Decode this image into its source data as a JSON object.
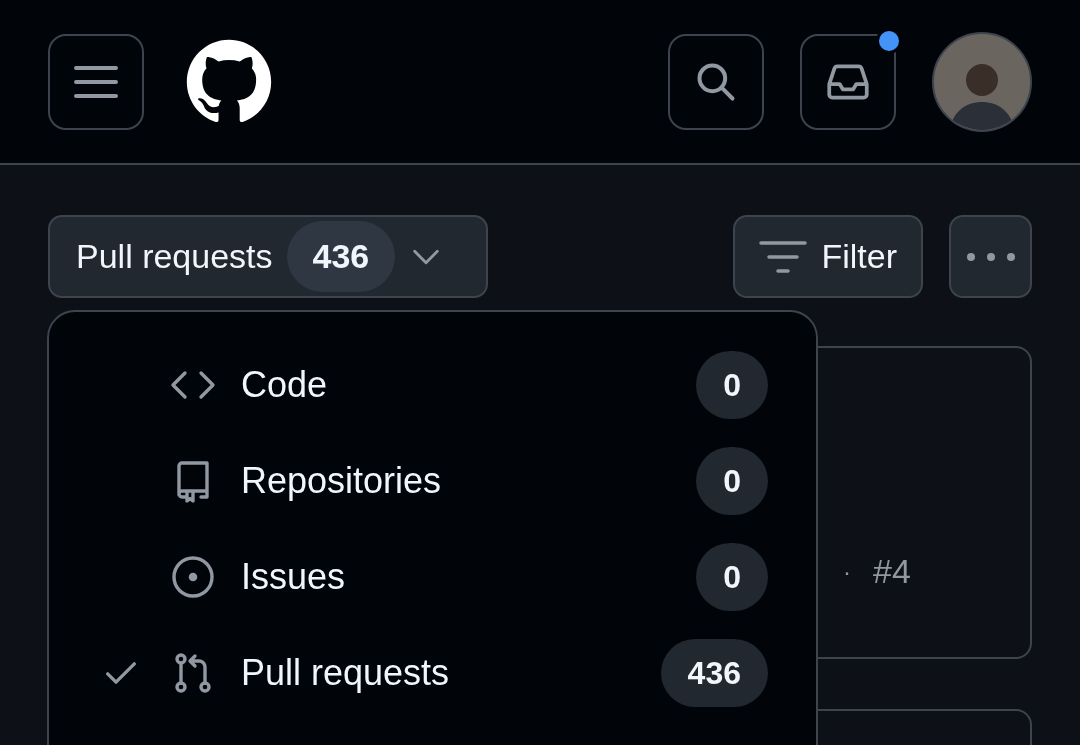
{
  "header": {
    "notification_unread": true
  },
  "toolbar": {
    "scope_label": "Pull requests",
    "scope_count": "436",
    "filter_label": "Filter"
  },
  "menu": {
    "items": [
      {
        "kind": "code",
        "label": "Code",
        "count": "0",
        "selected": false
      },
      {
        "kind": "repo",
        "label": "Repositories",
        "count": "0",
        "selected": false
      },
      {
        "kind": "issue",
        "label": "Issues",
        "count": "0",
        "selected": false
      },
      {
        "kind": "pull",
        "label": "Pull requests",
        "count": "436",
        "selected": true
      }
    ]
  },
  "results": [
    {
      "separator": "·",
      "number": "#4"
    }
  ],
  "more_results_below": true
}
